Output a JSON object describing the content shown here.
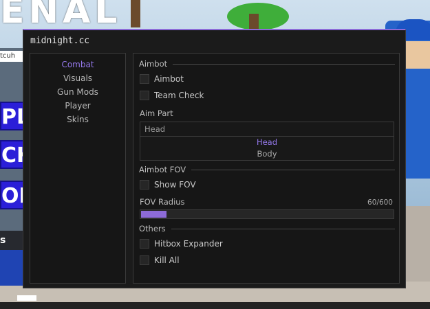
{
  "background": {
    "title_fragment": "ENAL",
    "name_tag": "tcuh",
    "tags": [
      "PL",
      "CK",
      "OP"
    ],
    "side_letter": "s"
  },
  "window": {
    "title": "midnight.cc",
    "accent_color": "#8d6bd8"
  },
  "sidebar": {
    "items": [
      {
        "label": "Combat",
        "active": true
      },
      {
        "label": "Visuals",
        "active": false
      },
      {
        "label": "Gun Mods",
        "active": false
      },
      {
        "label": "Player",
        "active": false
      },
      {
        "label": "Skins",
        "active": false
      }
    ]
  },
  "content": {
    "aimbot_section": {
      "title": "Aimbot",
      "aimbot_toggle": {
        "label": "Aimbot",
        "checked": false
      },
      "team_check_toggle": {
        "label": "Team Check",
        "checked": false
      },
      "aim_part": {
        "label": "Aim Part",
        "placeholder": "Head",
        "options": [
          "Head",
          "Body"
        ],
        "selected": "Head"
      }
    },
    "fov_section": {
      "title": "Aimbot FOV",
      "show_fov_toggle": {
        "label": "Show FOV",
        "checked": false
      },
      "fov_radius": {
        "label": "FOV Radius",
        "value": 60,
        "max": 600,
        "display": "60/600"
      }
    },
    "others_section": {
      "title": "Others",
      "hitbox_toggle": {
        "label": "Hitbox Expander",
        "checked": false
      },
      "kill_all_toggle": {
        "label": "Kill All",
        "checked": false
      }
    }
  }
}
